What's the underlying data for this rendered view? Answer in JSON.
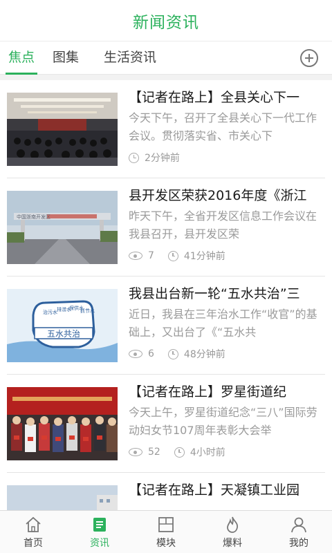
{
  "header": {
    "title": "新闻资讯"
  },
  "tabs": [
    {
      "label": "焦点",
      "active": true
    },
    {
      "label": "图集",
      "active": false
    },
    {
      "label": "生活资讯",
      "active": false
    }
  ],
  "news": [
    {
      "title": "【记者在路上】全县关心下一",
      "summary": "今天下午，召开了全县关心下一代工作会议。贯彻落实省、市关心下",
      "views": "",
      "time": "2分钟前",
      "image": "meeting-hall-photo"
    },
    {
      "title": "县开发区荣获2016年度《浙江",
      "summary": "昨天下午，全省开发区信息工作会议在我县召开，县开发区荣",
      "views": "7",
      "time": "41分钟前",
      "image": "development-zone-gate-photo"
    },
    {
      "title": "我县出台新一轮“五水共治”三",
      "summary": "近日，我县在三年治水工作“收官”的基础上，又出台了《“五水共",
      "views": "6",
      "time": "48分钟前",
      "image": "five-water-fist-logo"
    },
    {
      "title": "【记者在路上】罗星街道纪",
      "summary": "今天上午，罗星街道纪念“三八”国际劳动妇女节107周年表彰大会举",
      "views": "52",
      "time": "4小时前",
      "image": "awards-ceremony-photo"
    },
    {
      "title": "【记者在路上】天凝镇工业园",
      "summary": "",
      "views": "",
      "time": "",
      "image": "industrial-park-photo"
    }
  ],
  "thumb_text": {
    "gate_sign": "中国浙南开发区",
    "fist_words": [
      "治污水",
      "排涝水",
      "保供水",
      "抓节水"
    ],
    "fist_banner": "五水共治"
  },
  "bottom_nav": [
    {
      "label": "首页",
      "icon": "home-icon",
      "active": false
    },
    {
      "label": "资讯",
      "icon": "news-icon",
      "active": true
    },
    {
      "label": "模块",
      "icon": "modules-icon",
      "active": false
    },
    {
      "label": "爆料",
      "icon": "flame-icon",
      "active": false
    },
    {
      "label": "我的",
      "icon": "user-icon",
      "active": false
    }
  ],
  "colors": {
    "accent": "#2bb15c",
    "text": "#1a1a1a",
    "muted": "#9a9a9a"
  }
}
